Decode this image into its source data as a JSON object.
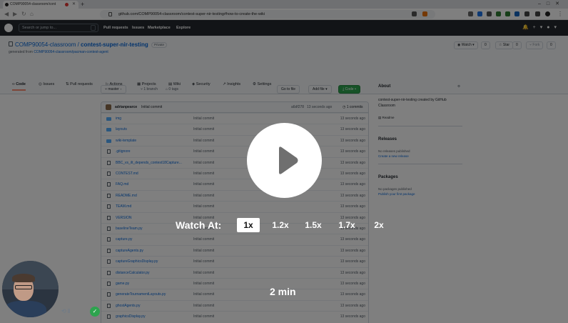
{
  "browser": {
    "tab_title": "COMP90054-classroom/cont",
    "url": "github.com/COMP90054-classroom/contest-super-nir-testing#how-to-create-the-wiki"
  },
  "github": {
    "search_placeholder": "Search or jump to...",
    "nav": [
      "Pull requests",
      "Issues",
      "Marketplace",
      "Explore"
    ],
    "owner": "COMP90054-classroom",
    "separator": " / ",
    "repo": "contest-super-nir-testing",
    "visibility": "Private",
    "generated_from_prefix": "generated from ",
    "generated_from": "COMP90054-classroom/pacman-contest-agent",
    "watch_label": "Watch",
    "watch_count": "0",
    "star_label": "Star",
    "star_count": "0",
    "fork_label": "Fork",
    "fork_count": "0",
    "tabs": [
      "Code",
      "Issues",
      "Pull requests",
      "Actions",
      "Projects",
      "Wiki",
      "Security",
      "Insights",
      "Settings"
    ],
    "branch": "master",
    "branches": "1 branch",
    "tags": "0 tags",
    "goto_file": "Go to file",
    "add_file": "Add file",
    "code_button": "Code",
    "commit": {
      "author": "adrianpearce",
      "message": "Initial commit",
      "sha": "a6df278",
      "ago": "13 seconds ago",
      "count": "1 commits"
    },
    "files": [
      {
        "name": "img",
        "type": "dir",
        "msg": "Initial commit",
        "age": "13 seconds ago"
      },
      {
        "name": "layouts",
        "type": "dir",
        "msg": "Initial commit",
        "age": "13 seconds ago"
      },
      {
        "name": "wiki-template",
        "type": "dir",
        "msg": "Initial commit",
        "age": "13 seconds ago"
      },
      {
        "name": ".gitignore",
        "type": "file",
        "msg": "Initial commit",
        "age": "13 seconds ago"
      },
      {
        "name": "BBC_vs_ilt_depends_contest18Capture...",
        "type": "file",
        "msg": "Initial commit",
        "age": "13 seconds ago"
      },
      {
        "name": "CONTEST.md",
        "type": "file",
        "msg": "Initial commit",
        "age": "13 seconds ago"
      },
      {
        "name": "FAQ.md",
        "type": "file",
        "msg": "Initial commit",
        "age": "13 seconds ago"
      },
      {
        "name": "README.md",
        "type": "file",
        "msg": "Initial commit",
        "age": "13 seconds ago"
      },
      {
        "name": "TEAM.md",
        "type": "file",
        "msg": "Initial commit",
        "age": "13 seconds ago"
      },
      {
        "name": "VERSION",
        "type": "file",
        "msg": "Initial commit",
        "age": "13 seconds ago"
      },
      {
        "name": "baselineTeam.py",
        "type": "file",
        "msg": "Initial commit",
        "age": "13 seconds ago"
      },
      {
        "name": "capture.py",
        "type": "file",
        "msg": "Initial commit",
        "age": "13 seconds ago"
      },
      {
        "name": "captureAgents.py",
        "type": "file",
        "msg": "Initial commit",
        "age": "13 seconds ago"
      },
      {
        "name": "captureGraphicsDisplay.py",
        "type": "file",
        "msg": "Initial commit",
        "age": "13 seconds ago"
      },
      {
        "name": "distanceCalculator.py",
        "type": "file",
        "msg": "Initial commit",
        "age": "13 seconds ago"
      },
      {
        "name": "game.py",
        "type": "file",
        "msg": "Initial commit",
        "age": "13 seconds ago"
      },
      {
        "name": "generateTournamentLayouts.py",
        "type": "file",
        "msg": "Initial commit",
        "age": "13 seconds ago"
      },
      {
        "name": "ghostAgents.py",
        "type": "file",
        "msg": "Initial commit",
        "age": "13 seconds ago"
      },
      {
        "name": "graphicsDisplay.py",
        "type": "file",
        "msg": "Initial commit",
        "age": "13 seconds ago"
      }
    ],
    "about": {
      "heading": "About",
      "description": "contest-super-nir-testing created by GitHub Classroom",
      "readme": "Readme"
    },
    "releases": {
      "heading": "Releases",
      "none": "No releases published",
      "link": "Create a new release"
    },
    "packages": {
      "heading": "Packages",
      "none": "No packages published",
      "link": "Publish your first package"
    }
  },
  "video": {
    "watch_at": "Watch At:",
    "speeds": [
      "1x",
      "1.2x",
      "1.5x",
      "1.7x",
      "2x"
    ],
    "selected_speed": "1x",
    "duration": "2 min"
  },
  "colors": {
    "overlay": "#000000",
    "accent_green": "#2da44e",
    "link_blue": "#0969da",
    "github_header": "#24292f"
  }
}
